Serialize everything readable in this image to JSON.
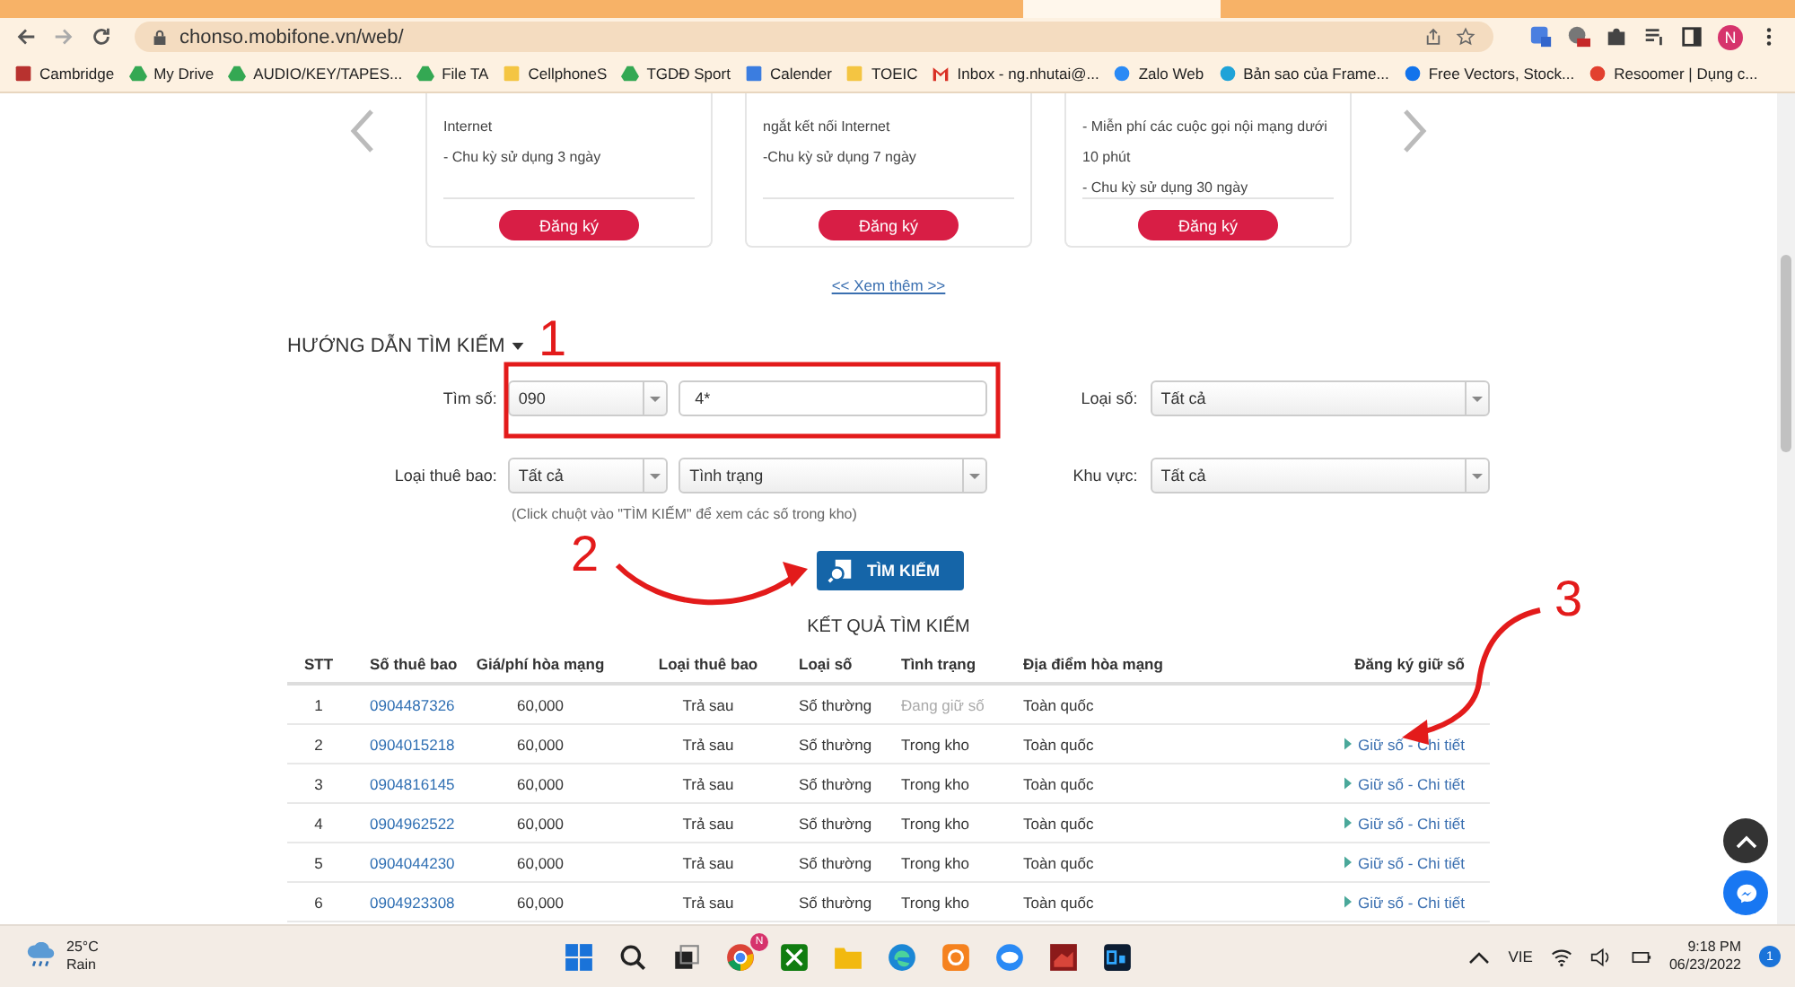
{
  "browser": {
    "url": "chonso.mobifone.vn/web/",
    "profile_initial": "N",
    "bookmarks": [
      {
        "label": "Cambridge",
        "kind": "shield"
      },
      {
        "label": "My Drive",
        "kind": "drive"
      },
      {
        "label": "AUDIO/KEY/TAPES...",
        "kind": "drive"
      },
      {
        "label": "File TA",
        "kind": "drive"
      },
      {
        "label": "CellphoneS",
        "kind": "folder"
      },
      {
        "label": "TGDĐ Sport",
        "kind": "drive"
      },
      {
        "label": "Calender",
        "kind": "calendar"
      },
      {
        "label": "TOEIC",
        "kind": "folder"
      },
      {
        "label": "Inbox - ng.nhutai@...",
        "kind": "mail"
      },
      {
        "label": "Zalo Web",
        "kind": "chat"
      },
      {
        "label": "Bản sao của Frame...",
        "kind": "circle"
      },
      {
        "label": "Free Vectors, Stock...",
        "kind": "vector"
      },
      {
        "label": "Resoomer | Dụng c...",
        "kind": "ring"
      }
    ]
  },
  "page": {
    "cards": [
      {
        "lines": [
          "Internet",
          "- Chu kỳ sử dụng 3 ngày"
        ],
        "button": "Đăng ký"
      },
      {
        "lines": [
          "ngắt kết nối Internet",
          "-Chu kỳ sử dụng 7 ngày"
        ],
        "button": "Đăng ký"
      },
      {
        "lines": [
          "- Miễn phí các cuộc gọi nội mạng dưới",
          "10 phút",
          "- Chu kỳ sử dụng 30 ngày"
        ],
        "button": "Đăng ký"
      }
    ],
    "more_link": "<< Xem thêm >>",
    "search": {
      "heading": "HƯỚNG DẪN TÌM KIẾM",
      "number_label": "Tìm số:",
      "prefix": "090",
      "pattern": "4*",
      "number_type_label": "Loại số:",
      "number_type": "Tất cả",
      "subscriber_label": "Loại thuê bao:",
      "subscriber": "Tất cả",
      "status": "Tình trạng",
      "region_label": "Khu vực:",
      "region": "Tất cả",
      "hint": "(Click chuột vào \"TÌM KIẾM\" để xem các số trong kho)",
      "button": "TÌM KIẾM"
    },
    "results": {
      "title": "KẾT QUẢ TÌM KIẾM",
      "columns": [
        "STT",
        "Số thuê bao",
        "Giá/phí hòa mạng",
        "Loại thuê bao",
        "Loại số",
        "Tình trạng",
        "Địa điểm hòa mạng",
        "Đăng ký giữ số"
      ],
      "rows": [
        {
          "stt": "1",
          "number": "0904487326",
          "price": "60,000",
          "subscriber": "Trả sau",
          "type": "Số thường",
          "status": "Đang giữ số",
          "available": false,
          "location": "Toàn quốc"
        },
        {
          "stt": "2",
          "number": "0904015218",
          "price": "60,000",
          "subscriber": "Trả sau",
          "type": "Số thường",
          "status": "Trong kho",
          "available": true,
          "location": "Toàn quốc",
          "action": "Giữ số - Chi tiết"
        },
        {
          "stt": "3",
          "number": "0904816145",
          "price": "60,000",
          "subscriber": "Trả sau",
          "type": "Số thường",
          "status": "Trong kho",
          "available": true,
          "location": "Toàn quốc",
          "action": "Giữ số - Chi tiết"
        },
        {
          "stt": "4",
          "number": "0904962522",
          "price": "60,000",
          "subscriber": "Trả sau",
          "type": "Số thường",
          "status": "Trong kho",
          "available": true,
          "location": "Toàn quốc",
          "action": "Giữ số - Chi tiết"
        },
        {
          "stt": "5",
          "number": "0904044230",
          "price": "60,000",
          "subscriber": "Trả sau",
          "type": "Số thường",
          "status": "Trong kho",
          "available": true,
          "location": "Toàn quốc",
          "action": "Giữ số - Chi tiết"
        },
        {
          "stt": "6",
          "number": "0904923308",
          "price": "60,000",
          "subscriber": "Trả sau",
          "type": "Số thường",
          "status": "Trong kho",
          "available": true,
          "location": "Toàn quốc",
          "action": "Giữ số - Chi tiết"
        }
      ]
    },
    "annotations": [
      "1",
      "2",
      "3"
    ]
  },
  "taskbar": {
    "temperature": "25°C",
    "weather": "Rain",
    "badge": "N",
    "language": "VIE",
    "time": "9:18 PM",
    "date": "06/23/2022",
    "notifications": "1"
  }
}
